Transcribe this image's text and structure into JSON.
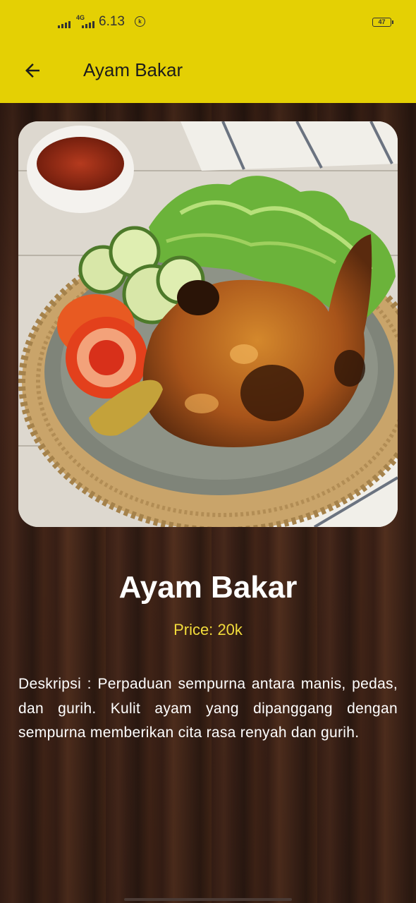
{
  "status_bar": {
    "network": "4G",
    "time": "6.13",
    "battery": "47"
  },
  "app_bar": {
    "title": "Ayam Bakar",
    "back_icon": "arrow-left-icon"
  },
  "food": {
    "name": "Ayam Bakar",
    "price_label": "Price:",
    "price_value": "20k",
    "description_label": "Deskripsi :",
    "description": "Perpaduan sempurna antara manis, pedas, dan gurih. Kulit ayam yang dipanggang dengan sempurna memberikan cita rasa renyah dan gurih."
  },
  "colors": {
    "appbar": "#e4d004",
    "price": "#f2dc3c",
    "text": "#ffffff"
  }
}
